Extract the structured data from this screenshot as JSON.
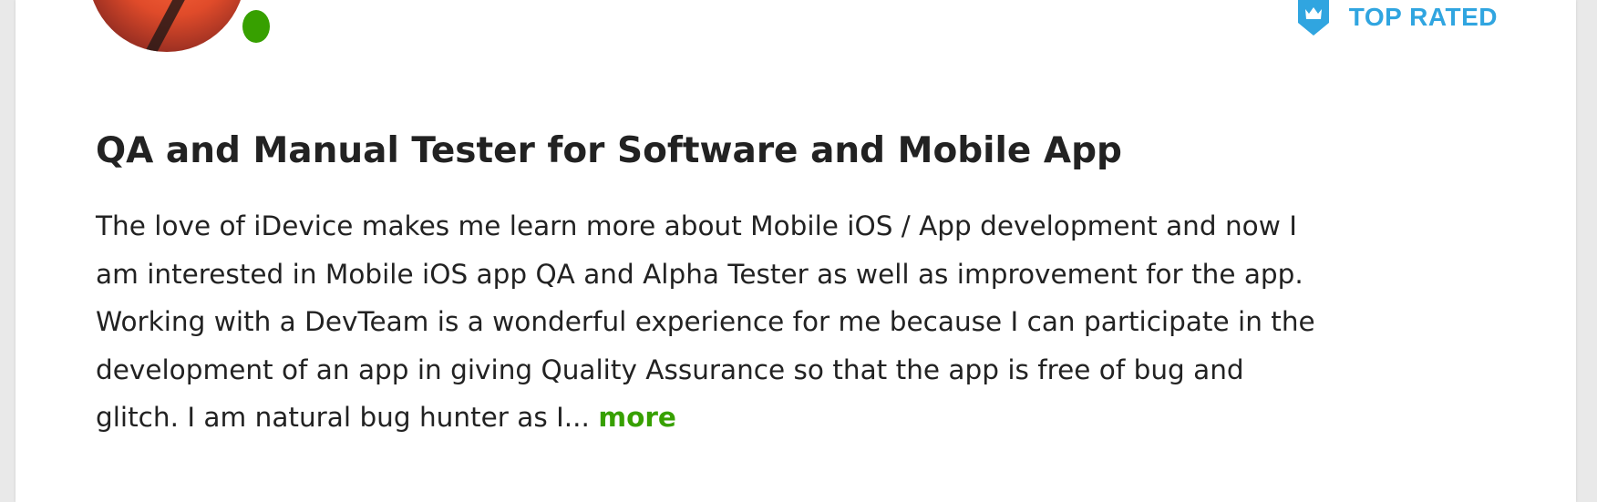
{
  "profile": {
    "badge_label": "TOP RATED",
    "status_color": "#37a000",
    "badge_color": "#30a5e0",
    "title": "QA and Manual Tester for Software and Mobile App",
    "description_lines": [
      "The love of iDevice makes me learn more about Mobile iOS / App development and now I",
      "am interested in Mobile iOS app QA and Alpha Tester as well as improvement for the app.",
      "Working with a DevTeam is a wonderful experience for me because I can participate in the",
      "development of an app in giving Quality Assurance so that the app is free of bug and",
      "glitch. I am natural bug hunter as I..."
    ],
    "more_label": "more",
    "icons": {
      "badge": "crown-shield-icon",
      "avatar": "profile-photo"
    }
  }
}
